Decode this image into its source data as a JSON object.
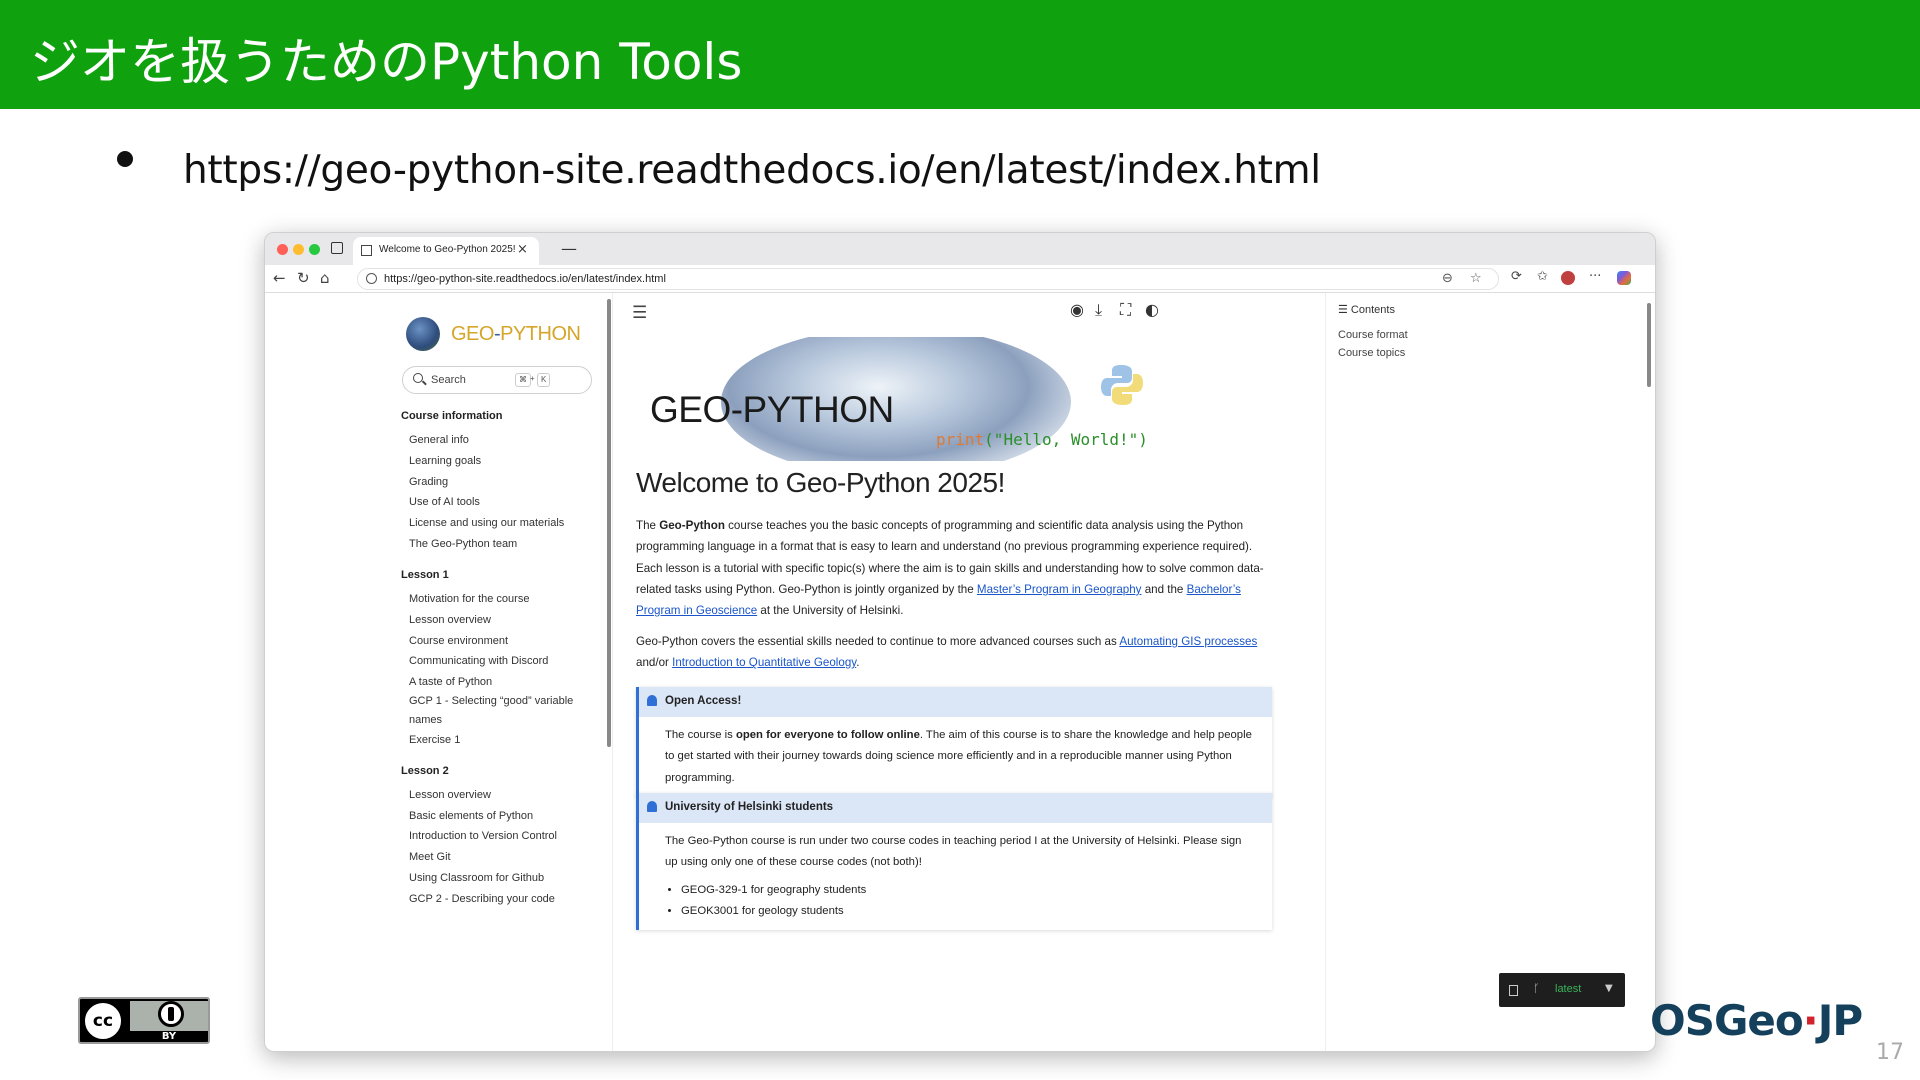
{
  "slide": {
    "title": "ジオを扱うためのPython Tools",
    "bullet_url": "https://geo-python-site.readthedocs.io/en/latest/index.html",
    "page_number": "17",
    "license_badge_label": "BY",
    "org_logo_text": "OSGeo",
    "org_logo_suffix": "JP",
    "header_color": "#10a10f"
  },
  "browser": {
    "tab_title": "Welcome to Geo-Python 2025!",
    "tab_close": "×",
    "new_tab": "—",
    "url": "https://geo-python-site.readthedocs.io/en/latest/index.html",
    "nav_icons": [
      "back-arrow-icon",
      "reload-icon",
      "home-icon"
    ],
    "toolbar_icons": [
      "translate-icon",
      "star-icon",
      "extensions-icon",
      "favorites-icon",
      "profile-icon",
      "more-icon",
      "copilot-icon"
    ]
  },
  "sidebar": {
    "logo_text_a": "GEO",
    "logo_text_b": "-",
    "logo_text_c": "PYTHON",
    "search_label": "Search",
    "search_keys": [
      "⌘",
      "+",
      "K"
    ],
    "sections": [
      {
        "caption": "Course information",
        "items": [
          "General info",
          "Learning goals",
          "Grading",
          "Use of AI tools",
          "License and using our materials",
          "The Geo-Python team"
        ]
      },
      {
        "caption": "Lesson 1",
        "items": [
          "Motivation for the course",
          "Lesson overview",
          "Course environment",
          "Communicating with Discord",
          "A taste of Python",
          "GCP 1 - Selecting “good” variable names",
          "Exercise 1"
        ]
      },
      {
        "caption": "Lesson 2",
        "items": [
          "Lesson overview",
          "Basic elements of Python",
          "Introduction to Version Control",
          "Meet Git",
          "Using Classroom for Github",
          "GCP 2 - Describing your code"
        ]
      }
    ]
  },
  "main": {
    "hero_title": "GEO-PYTHON",
    "hero_code_fn": "print",
    "hero_code_str": "(\"Hello, World!\")",
    "heading": "Welcome to Geo-Python 2025!",
    "para1": {
      "t1": "The ",
      "b1": "Geo-Python",
      "t2": " course teaches you the basic concepts of programming and scientific data analysis using the Python programming language in a format that is easy to learn and understand (no previous programming experience required). Each lesson is a tutorial with specific topic(s) where the aim is to gain skills and understanding how to solve common data-related tasks using Python. Geo-Python is jointly organized by the ",
      "link1": "Master’s Program in Geography",
      "t3": " and the ",
      "link2": "Bachelor’s Program in Geoscience",
      "t4": " at the University of Helsinki."
    },
    "para2": {
      "t1": "Geo-Python covers the essential skills needed to continue to more advanced courses such as ",
      "link1": "Automating GIS processes",
      "t2": " and/or ",
      "link2": "Introduction to Quantitative Geology",
      "t3": "."
    },
    "admonition1": {
      "title": "Open Access!",
      "t1": "The course is ",
      "b1": "open for everyone to follow online",
      "t2": ". The aim of this course is to share the knowledge and help people to get started with their journey towards doing science more efficiently and in a reproducible manner using Python programming."
    },
    "admonition2": {
      "title": "University of Helsinki students",
      "text": "The Geo-Python course is run under two course codes in teaching period I at the University of Helsinki. Please sign up using only one of these course codes (not both)!",
      "list": [
        "GEOG-329-1 for geography students",
        "GEOK3001 for geology students"
      ]
    }
  },
  "toc": {
    "heading": "Contents",
    "items": [
      "Course format",
      "Course topics"
    ]
  },
  "version_badge": {
    "label": "latest"
  }
}
